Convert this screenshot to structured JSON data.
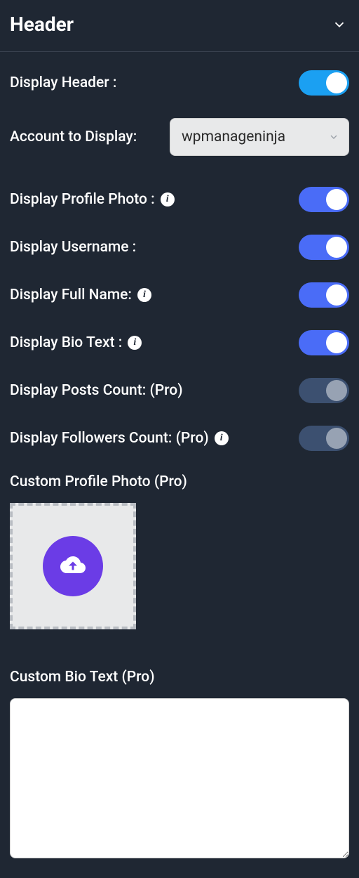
{
  "panel": {
    "title": "Header"
  },
  "settings": {
    "display_header": {
      "label": "Display Header :",
      "on": true
    },
    "account": {
      "label": "Account to Display:",
      "value": "wpmanageninja"
    },
    "display_profile_photo": {
      "label": "Display Profile Photo :",
      "on": true,
      "info": true
    },
    "display_username": {
      "label": "Display Username :",
      "on": true
    },
    "display_full_name": {
      "label": "Display Full Name:",
      "on": true,
      "info": true
    },
    "display_bio_text": {
      "label": "Display Bio Text :",
      "on": true,
      "info": true
    },
    "display_posts_count": {
      "label": "Display Posts Count: (Pro)",
      "on": false
    },
    "display_followers_count": {
      "label": "Display Followers Count: (Pro)",
      "on": false,
      "info": true
    },
    "custom_profile_photo": {
      "label": "Custom Profile Photo (Pro)"
    },
    "custom_bio_text": {
      "label": "Custom Bio Text (Pro)",
      "value": ""
    }
  }
}
